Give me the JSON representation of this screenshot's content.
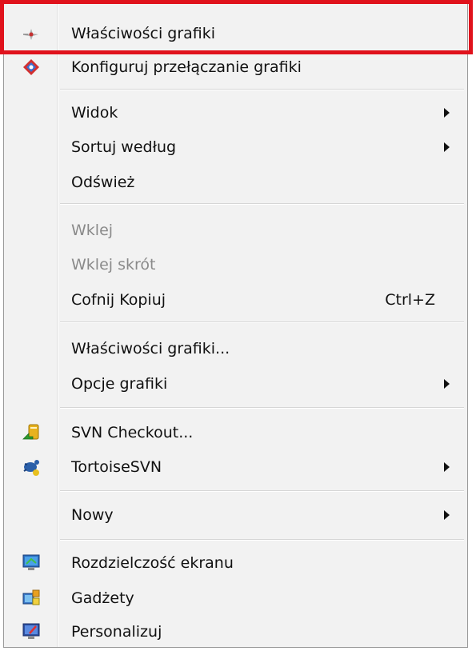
{
  "menu": {
    "items": [
      {
        "label": "Właściwości grafiki",
        "icon": "graphics-properties-icon"
      },
      {
        "label": "Konfiguruj przełączanie grafiki",
        "icon": "switchable-graphics-icon"
      },
      {
        "label": "Widok",
        "submenu": true
      },
      {
        "label": "Sortuj według",
        "submenu": true
      },
      {
        "label": "Odśwież"
      },
      {
        "label": "Wklej",
        "disabled": true
      },
      {
        "label": "Wklej skrót",
        "disabled": true
      },
      {
        "label": "Cofnij Kopiuj",
        "shortcut": "Ctrl+Z"
      },
      {
        "label": "Właściwości grafiki..."
      },
      {
        "label": "Opcje grafiki",
        "submenu": true
      },
      {
        "label": "SVN Checkout...",
        "icon": "svn-checkout-icon"
      },
      {
        "label": "TortoiseSVN",
        "icon": "tortoisesvn-icon",
        "submenu": true
      },
      {
        "label": "Nowy",
        "submenu": true
      },
      {
        "label": "Rozdzielczość ekranu",
        "icon": "screen-resolution-icon"
      },
      {
        "label": "Gadżety",
        "icon": "gadgets-icon"
      },
      {
        "label": "Personalizuj",
        "icon": "personalize-icon"
      }
    ]
  },
  "colors": {
    "highlight": "#e0121c",
    "menu_background": "#f2f2f2",
    "disabled_text": "#8a8a8a"
  }
}
